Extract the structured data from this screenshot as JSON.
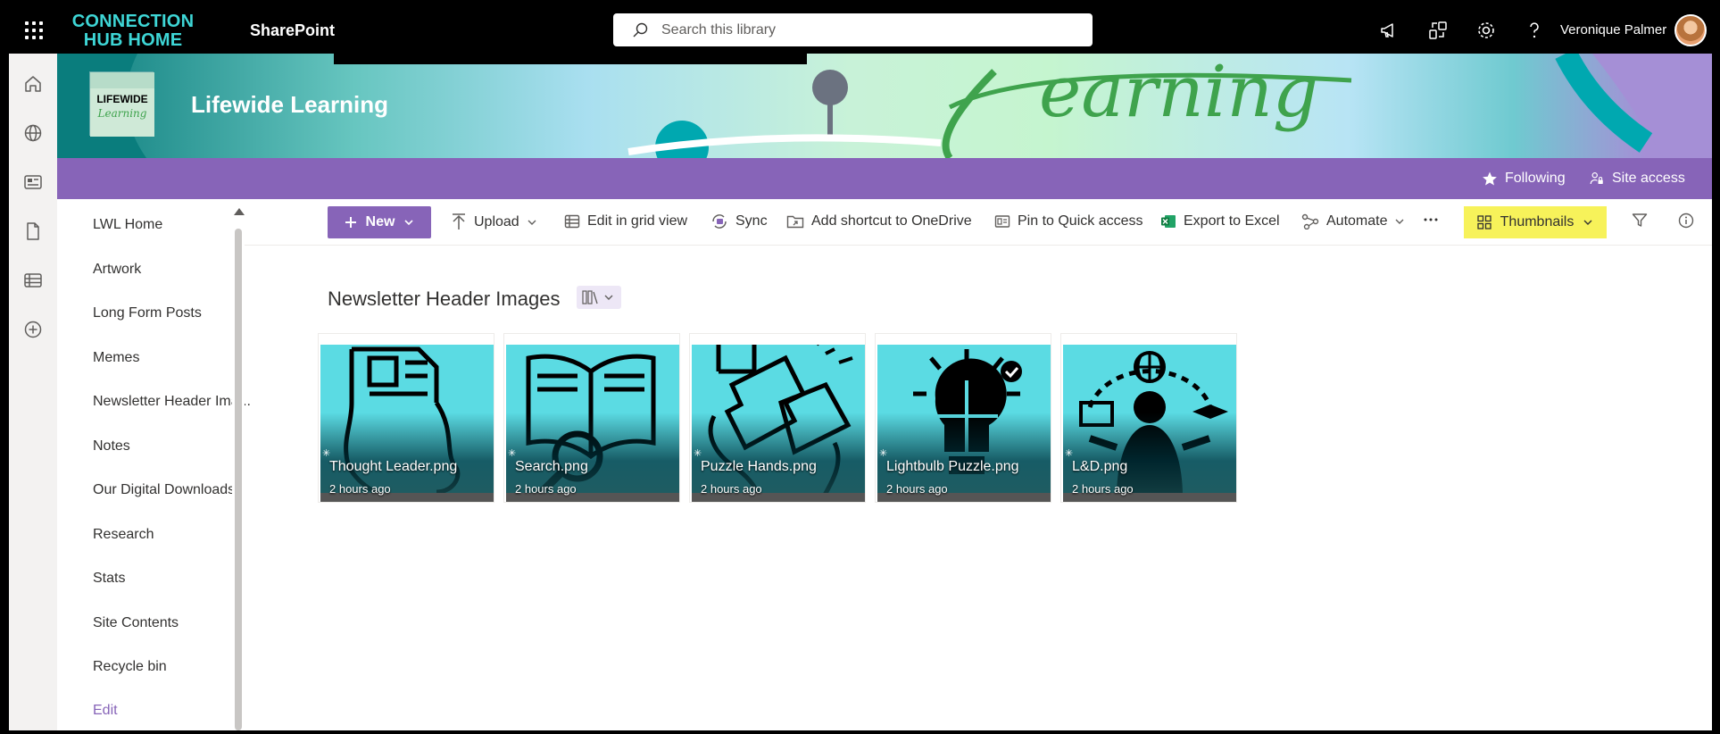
{
  "suite_bar": {
    "hub_name": "CONNECTION HUB HOME",
    "app_name": "SharePoint",
    "search_placeholder": "Search this library",
    "user_name": "Veronique Palmer"
  },
  "site": {
    "title": "Lifewide Learning",
    "logo_text": "LIFEWIDE Learning",
    "following_label": "Following",
    "site_access_label": "Site access"
  },
  "left_nav": [
    {
      "label": "LWL Home"
    },
    {
      "label": "Artwork"
    },
    {
      "label": "Long Form Posts"
    },
    {
      "label": "Memes"
    },
    {
      "label": "Newsletter Header Ima..."
    },
    {
      "label": "Notes"
    },
    {
      "label": "Our Digital Downloads"
    },
    {
      "label": "Research"
    },
    {
      "label": "Stats"
    },
    {
      "label": "Site Contents"
    },
    {
      "label": "Recycle bin"
    },
    {
      "label": "Edit"
    }
  ],
  "command_bar": {
    "new_label": "New",
    "upload_label": "Upload",
    "grid_label": "Edit in grid view",
    "sync_label": "Sync",
    "shortcut_label": "Add shortcut to OneDrive",
    "pin_label": "Pin to Quick access",
    "export_label": "Export to Excel",
    "automate_label": "Automate",
    "view_label": "Thumbnails"
  },
  "library": {
    "title": "Newsletter Header Images",
    "files": [
      {
        "name": "Thought Leader.png",
        "modified": "2 hours ago",
        "icon": "thought-leader-icon"
      },
      {
        "name": "Search.png",
        "modified": "2 hours ago",
        "icon": "search-book-icon"
      },
      {
        "name": "Puzzle Hands.png",
        "modified": "2 hours ago",
        "icon": "puzzle-hands-icon"
      },
      {
        "name": "Lightbulb Puzzle.png",
        "modified": "2 hours ago",
        "icon": "lightbulb-puzzle-icon"
      },
      {
        "name": "L&D.png",
        "modified": "2 hours ago",
        "icon": "learning-development-icon"
      }
    ]
  },
  "colors": {
    "accent": "#8764b8",
    "thumbnails_highlight": "#f7f25a",
    "tile_background": "#5bdbe3",
    "hub_text": "#3ed6d6"
  }
}
